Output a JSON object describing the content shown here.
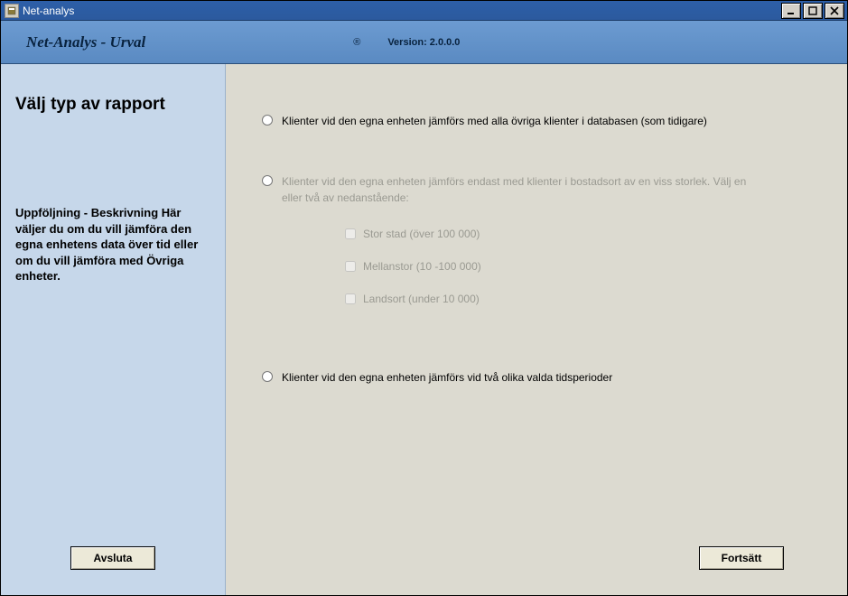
{
  "window": {
    "title": "Net-analys"
  },
  "subheader": {
    "product_title": "Net-Analys - Urval",
    "registered_mark": "®",
    "version_label": "Version: 2.0.0.0"
  },
  "sidebar": {
    "heading": "Välj typ av rapport",
    "description": "Uppföljning - Beskrivning Här väljer du om du vill jämföra den egna enhetens data över tid eller om du vill jämföra med Övriga enheter.",
    "button_exit": "Avsluta"
  },
  "main": {
    "radios": [
      {
        "label": "Klienter vid den egna enheten jämförs med alla övriga klienter i databasen (som tidigare)"
      },
      {
        "label": "Klienter vid den egna enheten jämförs endast med klienter i bostadsort av en viss storlek. Välj en eller två av nedanstående:"
      },
      {
        "label": "Klienter vid den egna enheten jämförs vid två olika valda tidsperioder"
      }
    ],
    "checkboxes": [
      {
        "label": "Stor stad (över 100 000)"
      },
      {
        "label": "Mellanstor (10 -100 000)"
      },
      {
        "label": "Landsort (under 10 000)"
      }
    ],
    "button_continue": "Fortsätt"
  },
  "colors": {
    "titlebar": "#2d5fa8",
    "subheader": "#5a8ac2",
    "sidebar": "#c6d7ea",
    "main": "#dcdad0",
    "disabled_text": "#9a9a92"
  }
}
